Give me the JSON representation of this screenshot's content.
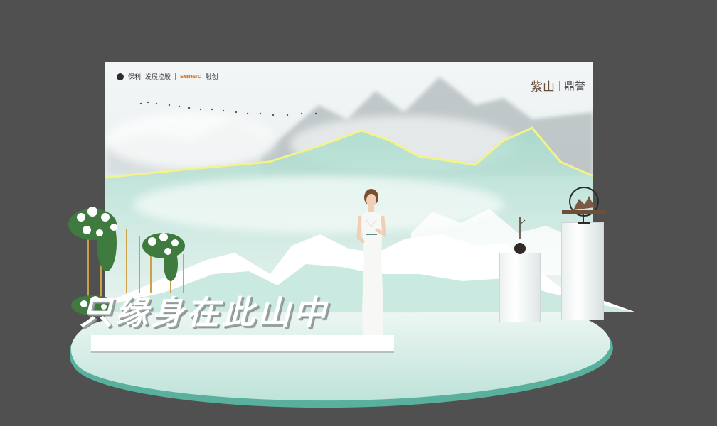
{
  "scene": {
    "description_type": "event-stage-rendering",
    "background_color": "#505050"
  },
  "brands": {
    "left": {
      "name_1": "保利",
      "name_2": "发展控股",
      "name_3": "sunac",
      "name_4": "融创"
    },
    "right": {
      "project": "紫山",
      "title": "鼎誉"
    }
  },
  "slogan": "只缘身在此山中",
  "colors": {
    "mountain_teal": "#8fcfc0",
    "glow_yellow": "#f4f28a",
    "forest_green": "#2f6e4f",
    "base_teal": "#b8e0d6"
  }
}
